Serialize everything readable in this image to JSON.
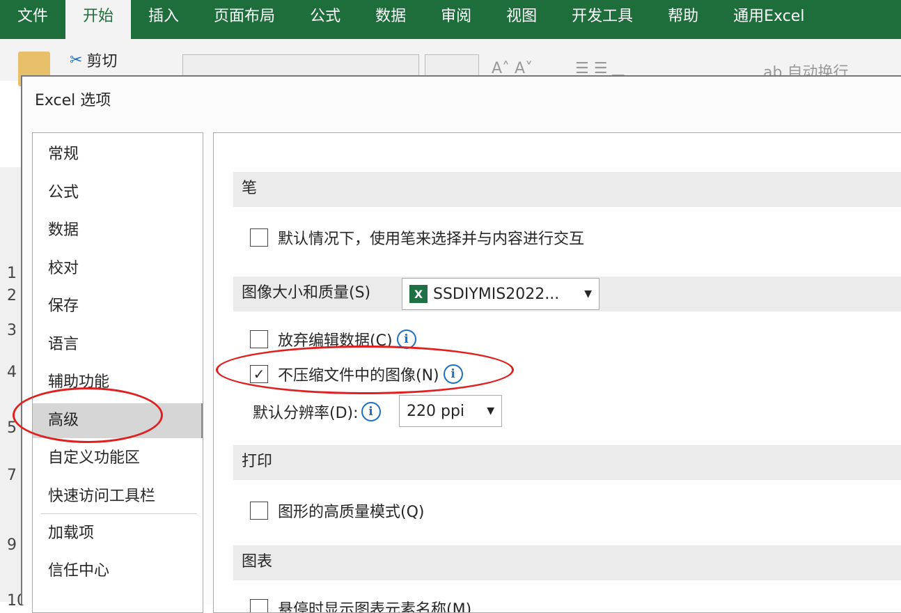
{
  "ribbon_tabs": [
    "文件",
    "开始",
    "插入",
    "页面布局",
    "公式",
    "数据",
    "审阅",
    "视图",
    "开发工具",
    "帮助",
    "通用Excel"
  ],
  "active_tab": "开始",
  "ribbon": {
    "cut": "剪切",
    "wrap_text": "自动换行"
  },
  "row_numbers": [
    "1",
    "2",
    "3",
    "4",
    "5",
    "7",
    "9",
    "10"
  ],
  "dialog": {
    "title": "Excel 选项",
    "nav": [
      "常规",
      "公式",
      "数据",
      "校对",
      "保存",
      "语言",
      "辅助功能",
      "高级",
      "自定义功能区",
      "快速访问工具栏",
      "加载项",
      "信任中心"
    ],
    "selected_nav": "高级",
    "sections": {
      "pen": {
        "title": "笔",
        "options": [
          {
            "label": "默认情况下，使用笔来选择并与内容进行交互",
            "checked": false
          }
        ]
      },
      "image": {
        "title": "图像大小和质量(S)",
        "workbook": "SSDIYMIS2022...",
        "discard": {
          "label": "放弃编辑数据(C)",
          "checked": false
        },
        "no_compress": {
          "label": "不压缩文件中的图像(N)",
          "checked": true
        },
        "resolution_label": "默认分辨率(D):",
        "resolution": "220 ppi"
      },
      "print": {
        "title": "打印",
        "options": [
          {
            "label": "图形的高质量模式(Q)",
            "checked": false
          }
        ]
      },
      "chart": {
        "title": "图表",
        "options": [
          {
            "label": "悬停时显示图表元素名称(M)",
            "checked": false
          }
        ]
      }
    }
  },
  "icons": {
    "info": "i",
    "check": "✓",
    "dropdown": "▼",
    "excel": "X"
  },
  "colors": {
    "ribbon": "#1e6e3c",
    "annotation": "#e02020",
    "info": "#1a6fc4"
  }
}
